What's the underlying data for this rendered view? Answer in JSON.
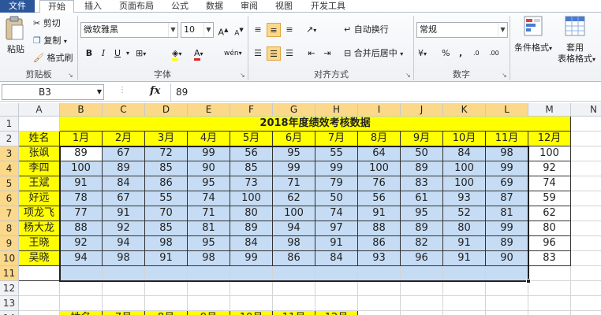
{
  "tabs": [
    "文件",
    "开始",
    "插入",
    "页面布局",
    "公式",
    "数据",
    "审阅",
    "视图",
    "开发工具"
  ],
  "clipboard": {
    "paste": "粘贴",
    "cut": "剪切",
    "copy": "复制",
    "format_painter": "格式刷",
    "group": "剪贴板"
  },
  "font": {
    "name": "微软雅黑",
    "size": "10",
    "bold": "B",
    "italic": "I",
    "underline": "U",
    "grow": "A",
    "shrink": "A",
    "group": "字体",
    "font_color": "A",
    "phonetic": "wén"
  },
  "alignment": {
    "wrap": "自动换行",
    "merge": "合并后居中",
    "group": "对齐方式"
  },
  "number": {
    "format": "常规",
    "percent": "%",
    "comma": ",",
    "inc_decimal": ".0",
    "dec_decimal": ".00",
    "currency": "¥",
    "group": "数字"
  },
  "styles": {
    "conditional": "条件格式",
    "table_line1": "套用",
    "table_line2": "表格格式"
  },
  "formula_bar": {
    "cell_ref": "B3",
    "fx": "fx",
    "content": "89"
  },
  "columns": [
    "A",
    "B",
    "C",
    "D",
    "E",
    "F",
    "G",
    "H",
    "I",
    "J",
    "K",
    "L",
    "M",
    "N"
  ],
  "rows": [
    "1",
    "2",
    "3",
    "4",
    "5",
    "6",
    "7",
    "8",
    "9",
    "10",
    "11",
    "12",
    "13",
    "14"
  ],
  "sheet": {
    "title": "2018年度绩效考核数据",
    "header": [
      "姓名",
      "1月",
      "2月",
      "3月",
      "4月",
      "5月",
      "6月",
      "7月",
      "8月",
      "9月",
      "10月",
      "11月",
      "12月"
    ],
    "records": [
      [
        "张飒",
        "89",
        "67",
        "72",
        "99",
        "56",
        "95",
        "55",
        "64",
        "50",
        "84",
        "98",
        "100"
      ],
      [
        "李四",
        "100",
        "89",
        "85",
        "90",
        "85",
        "99",
        "99",
        "100",
        "89",
        "100",
        "99",
        "92"
      ],
      [
        "王斌",
        "91",
        "84",
        "86",
        "95",
        "73",
        "71",
        "79",
        "76",
        "83",
        "100",
        "69",
        "74"
      ],
      [
        "好远",
        "78",
        "67",
        "55",
        "74",
        "100",
        "62",
        "50",
        "56",
        "61",
        "93",
        "87",
        "59"
      ],
      [
        "项龙飞",
        "77",
        "91",
        "70",
        "71",
        "80",
        "100",
        "74",
        "91",
        "95",
        "52",
        "81",
        "62"
      ],
      [
        "杨大龙",
        "88",
        "92",
        "85",
        "81",
        "89",
        "94",
        "97",
        "88",
        "89",
        "80",
        "99",
        "80"
      ],
      [
        "王晓",
        "92",
        "94",
        "98",
        "95",
        "84",
        "98",
        "91",
        "86",
        "82",
        "91",
        "89",
        "96"
      ],
      [
        "吴晓",
        "94",
        "98",
        "91",
        "98",
        "99",
        "86",
        "84",
        "93",
        "96",
        "91",
        "90",
        "83"
      ]
    ],
    "lower_header": [
      "姓名",
      "7月",
      "8月",
      "9月",
      "10月",
      "11月",
      "12月"
    ]
  },
  "colors": {
    "yellow": "#ffff00",
    "selection_blue": "#c5dcf4",
    "file_tab": "#2b579a"
  }
}
